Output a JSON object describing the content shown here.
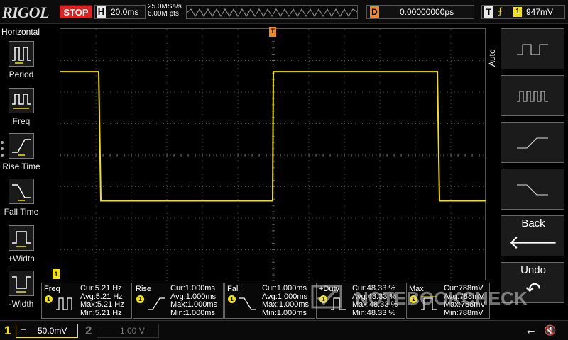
{
  "topbar": {
    "logo": "RIGOL",
    "run_state": "STOP",
    "timebase_label": "H",
    "timebase": "20.0ms",
    "sample_rate": "25.0MSa/s",
    "memory_depth": "6.00M pts",
    "delay_label": "D",
    "delay": "0.00000000ps",
    "trigger_label": "T",
    "trigger_edge": "⨍",
    "trigger_channel": "1",
    "trigger_level": "947mV",
    "trigger_marker": "T"
  },
  "left_menu": {
    "title": "Horizontal",
    "items": [
      {
        "label": "Period",
        "icon": "period-icon"
      },
      {
        "label": "Freq",
        "icon": "frequency-icon"
      },
      {
        "label": "Rise Time",
        "icon": "rise-time-icon"
      },
      {
        "label": "Fall Time",
        "icon": "fall-time-icon"
      },
      {
        "label": "+Width",
        "icon": "positive-width-icon"
      },
      {
        "label": "-Width",
        "icon": "negative-width-icon"
      }
    ]
  },
  "right_menu": {
    "mode": "Auto",
    "buttons": [
      {
        "icon": "slow-square-wave-icon"
      },
      {
        "icon": "fast-square-wave-icon"
      },
      {
        "icon": "rising-edge-icon"
      },
      {
        "icon": "falling-edge-icon"
      },
      {
        "label": "Back",
        "glyph": "🡐"
      },
      {
        "label": "Undo",
        "glyph": "↶"
      }
    ]
  },
  "waveform": {
    "channel": "1",
    "color": "#f5e400",
    "high_level_divs": 2.65,
    "low_level_divs": -1.45,
    "transitions_divs": [
      [
        0,
        "high"
      ],
      [
        0.9,
        "low"
      ],
      [
        5.0,
        "high"
      ],
      [
        8.9,
        "low"
      ],
      [
        10,
        "low"
      ]
    ]
  },
  "measurements": [
    {
      "name": "Freq",
      "channel": "1",
      "cur": "Cur:5.21 Hz",
      "avg": "Avg:5.21 Hz",
      "max": "Max:5.21 Hz",
      "min": "Min:5.21 Hz"
    },
    {
      "name": "Rise",
      "channel": "1",
      "cur": "Cur:1.000ms",
      "avg": "Avg:1.000ms",
      "max": "Max:1.000ms",
      "min": "Min:1.000ms"
    },
    {
      "name": "Fall",
      "channel": "1",
      "cur": "Cur:1.000ms",
      "avg": "Avg:1.000ms",
      "max": "Max:1.000ms",
      "min": "Min:1.000ms"
    },
    {
      "name": "+Duty",
      "channel": "1",
      "cur": "Cur:48.33 %",
      "avg": "Avg:48.33 %",
      "max": "Max:48.33 %",
      "min": "Min:48.33 %"
    },
    {
      "name": "Max",
      "channel": "1",
      "cur": "Cur:788mV",
      "avg": "Avg:788mV",
      "max": "Max:788mV",
      "min": "Min:788mV"
    }
  ],
  "bottombar": {
    "ch1_label": "1",
    "ch1_coupling": "═",
    "ch1_scale": "50.0mV",
    "ch2_label": "2",
    "ch2_scale": "1.00 V"
  },
  "watermark": "NOTEBOOKCHECK",
  "colors": {
    "ch1": "#f5e400",
    "trigger": "#f08a1a",
    "stop": "#dd2222",
    "grid": "#4a4a4a"
  }
}
